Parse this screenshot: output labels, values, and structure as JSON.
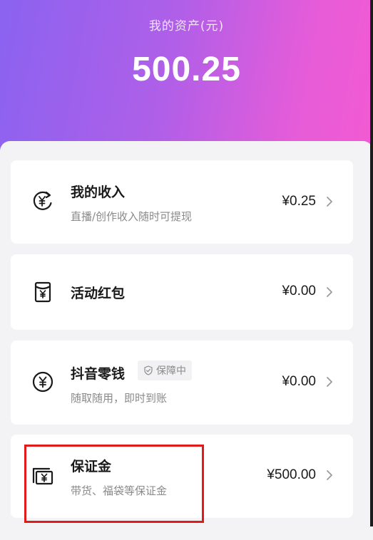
{
  "header": {
    "title": "我的资产(元)",
    "total": "500.25"
  },
  "cards": [
    {
      "title": "我的收入",
      "subtitle": "直播/创作收入随时可提现",
      "amount": "¥0.25",
      "icon": "yen-return-icon"
    },
    {
      "title": "活动红包",
      "amount": "¥0.00",
      "icon": "red-envelope-icon"
    },
    {
      "title": "抖音零钱",
      "badge": "保障中",
      "subtitle": "随取随用，即时到账",
      "amount": "¥0.00",
      "icon": "yen-coin-icon"
    },
    {
      "title": "保证金",
      "subtitle": "带货、福袋等保证金",
      "amount": "¥500.00",
      "icon": "deposit-icon"
    }
  ],
  "colors": {
    "header_gradient_start": "#8a63f0",
    "header_gradient_end": "#f25ad2",
    "highlight_border": "#e11a1a"
  }
}
